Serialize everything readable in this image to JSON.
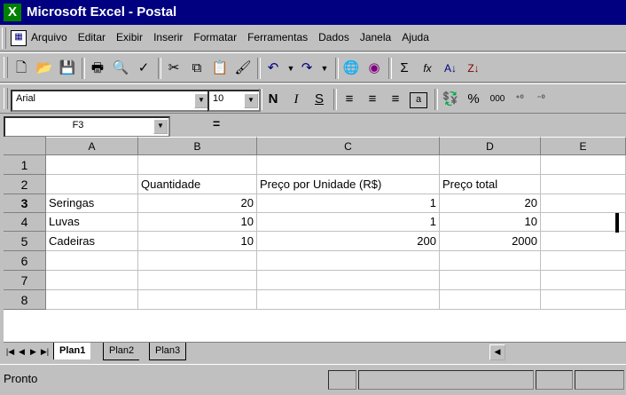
{
  "window": {
    "app_icon": "X",
    "title": "Microsoft Excel - Postal"
  },
  "menu": {
    "items": [
      "Arquivo",
      "Editar",
      "Exibir",
      "Inserir",
      "Formatar",
      "Ferramentas",
      "Dados",
      "Janela",
      "Ajuda"
    ]
  },
  "toolbar_format": {
    "font_name": "Arial",
    "font_size": "10",
    "bold": "N",
    "italic": "I",
    "underline": "S",
    "percent": "%",
    "thousands": "000"
  },
  "toolbar_standard": {
    "sum": "Σ",
    "function": "fx"
  },
  "formula_bar": {
    "name_box": "F3",
    "equals": "="
  },
  "grid": {
    "columns": [
      "A",
      "B",
      "C",
      "D",
      "E"
    ],
    "rows": [
      "1",
      "2",
      "3",
      "4",
      "5",
      "6",
      "7",
      "8"
    ],
    "active_row": "3",
    "cells": {
      "B2": "Quantidade",
      "C2": "Preço por Unidade (R$)",
      "D2": "Preço total",
      "A3": "Seringas",
      "B3": "20",
      "C3": "1",
      "D3": "20",
      "A4": "Luvas",
      "B4": "10",
      "C4": "1",
      "D4": "10",
      "A5": "Cadeiras",
      "B5": "10",
      "C5": "200",
      "D5": "2000"
    }
  },
  "sheets": {
    "tabs": [
      "Plan1",
      "Plan2",
      "Plan3"
    ],
    "active": "Plan1"
  },
  "status": {
    "text": "Pronto"
  }
}
